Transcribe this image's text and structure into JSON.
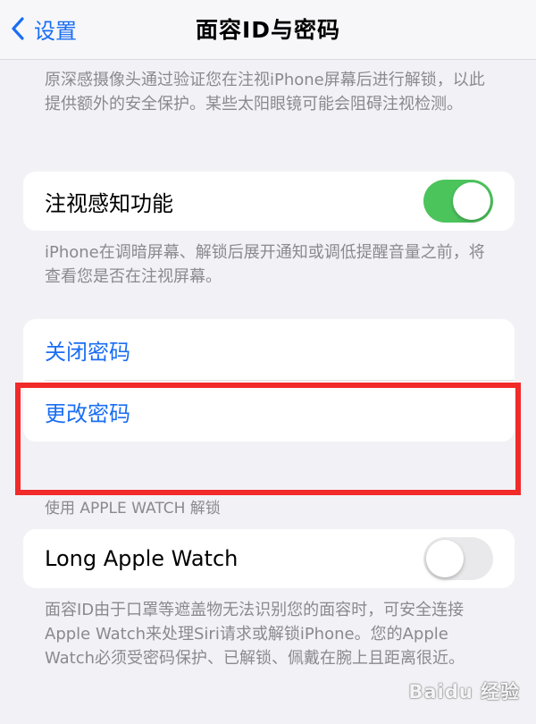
{
  "nav": {
    "back_label": "设置",
    "title": "面容ID与密码"
  },
  "attention_note": "原深感摄像头通过验证您在注视iPhone屏幕后进行解锁，以此提供额外的安全保护。某些太阳眼镜可能会阻碍注视检测。",
  "attention_aware": {
    "label": "注视感知功能",
    "enabled": true
  },
  "attention_aware_note": "iPhone在调暗屏幕、解锁后展开通知或调低提醒音量之前，将查看您是否在注视屏幕。",
  "passcode": {
    "turn_off_label": "关闭密码",
    "change_label": "更改密码"
  },
  "apple_watch_section": {
    "header": "使用 APPLE WATCH 解锁",
    "watch_name": "Long Apple Watch",
    "enabled": false,
    "note": "面容ID由于口罩等遮盖物无法识别您的面容时，可安全连接Apple Watch来处理Siri请求或解锁iPhone。您的Apple Watch必须受密码保护、已解锁、佩戴在腕上且距离很近。"
  },
  "watermark": "Baidu 经验",
  "colors": {
    "accent": "#1b6ef3",
    "toggle_on": "#4cc45c",
    "toggle_off": "#e9e9eb",
    "highlight": "#f12a2a",
    "background": "#f2f2f6"
  }
}
